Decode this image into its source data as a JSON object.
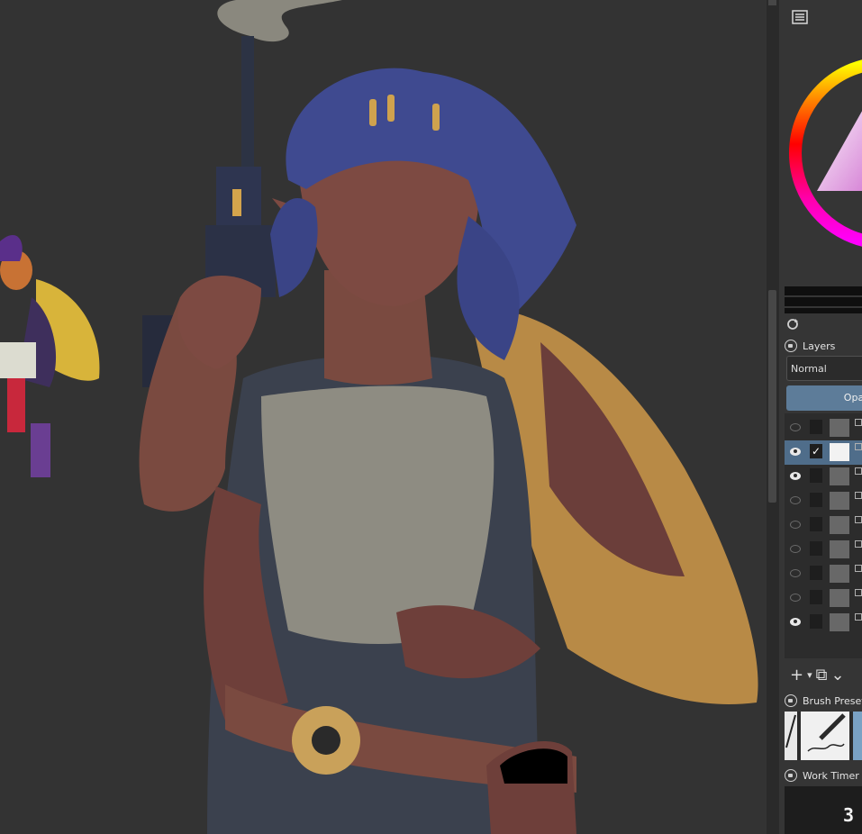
{
  "canvas": {
    "artwork": "character illustration"
  },
  "dock": {
    "layers_panel": {
      "title": "Layers",
      "blend_mode": "Normal",
      "opacity_label": "Opa",
      "layers": [
        {
          "visible": false,
          "selected": false,
          "checked": false
        },
        {
          "visible": true,
          "selected": true,
          "checked": true
        },
        {
          "visible": true,
          "selected": false,
          "checked": false
        },
        {
          "visible": false,
          "selected": false,
          "checked": false
        },
        {
          "visible": false,
          "selected": false,
          "checked": false
        },
        {
          "visible": false,
          "selected": false,
          "checked": false
        },
        {
          "visible": false,
          "selected": false,
          "checked": false
        },
        {
          "visible": false,
          "selected": false,
          "checked": false
        },
        {
          "visible": true,
          "selected": false,
          "checked": false
        }
      ],
      "tools": {
        "add": "+",
        "add_dropdown": "▾",
        "duplicate": "⧉",
        "more": "⌄"
      }
    },
    "brush_presets": {
      "title": "Brush Preset"
    },
    "work_timer": {
      "title": "Work Timer",
      "value": "3"
    },
    "check_mark": "✓"
  },
  "icons": [
    "panel-list-icon",
    "refresh-icon",
    "lock-icon",
    "eye-icon",
    "add-layer-icon",
    "duplicate-layer-icon"
  ],
  "colors": {
    "canvas_bg": "#333333",
    "panel_bg": "#353535",
    "accent": "#5d7c99",
    "selection": "#4f6d8a"
  }
}
